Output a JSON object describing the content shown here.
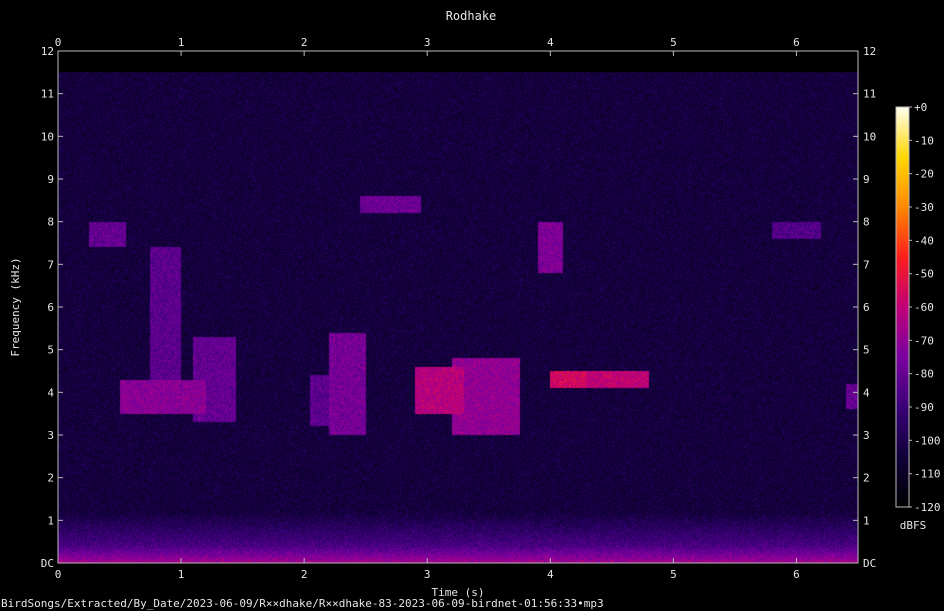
{
  "chart_data": {
    "type": "heatmap",
    "subtype": "spectrogram",
    "title": "Rodhake",
    "xlabel": "Time (s)",
    "ylabel": "Frequency (kHz)",
    "xlim": [
      0,
      6.5
    ],
    "ylim": [
      0,
      12
    ],
    "x_ticks": [
      "0",
      "1",
      "2",
      "3",
      "4",
      "5",
      "6"
    ],
    "y_ticks": [
      "DC",
      "1",
      "2",
      "3",
      "4",
      "5",
      "6",
      "7",
      "8",
      "9",
      "10",
      "11",
      "12"
    ],
    "colorbar": {
      "label": "dBFS",
      "range": [
        -120,
        0
      ],
      "ticks": [
        "+0",
        "-10",
        "-20",
        "-30",
        "-40",
        "-50",
        "-60",
        "-70",
        "-80",
        "-90",
        "-100",
        "-110",
        "-120"
      ],
      "colormap": [
        "#000000",
        "#10003a",
        "#3a0078",
        "#7a00a0",
        "#c0007a",
        "#ff1e1e",
        "#ff8800",
        "#ffd800",
        "#fffff0"
      ]
    },
    "noise_ceiling_khz": 11.5,
    "bird_calls": [
      {
        "t_start": 0.25,
        "t_end": 0.55,
        "f_low": 7.4,
        "f_high": 8.0,
        "level_dbfs": -80
      },
      {
        "t_start": 0.5,
        "t_end": 1.2,
        "f_low": 3.5,
        "f_high": 4.3,
        "level_dbfs": -72
      },
      {
        "t_start": 0.75,
        "t_end": 1.0,
        "f_low": 4.3,
        "f_high": 7.4,
        "level_dbfs": -82
      },
      {
        "t_start": 1.1,
        "t_end": 1.45,
        "f_low": 3.3,
        "f_high": 5.3,
        "level_dbfs": -80
      },
      {
        "t_start": 2.05,
        "t_end": 2.25,
        "f_low": 3.2,
        "f_high": 4.4,
        "level_dbfs": -82
      },
      {
        "t_start": 2.2,
        "t_end": 2.5,
        "f_low": 3.0,
        "f_high": 5.4,
        "level_dbfs": -76
      },
      {
        "t_start": 2.45,
        "t_end": 2.95,
        "f_low": 8.2,
        "f_high": 8.6,
        "level_dbfs": -78
      },
      {
        "t_start": 2.9,
        "t_end": 3.3,
        "f_low": 3.5,
        "f_high": 4.6,
        "level_dbfs": -62
      },
      {
        "t_start": 3.2,
        "t_end": 3.75,
        "f_low": 3.0,
        "f_high": 4.8,
        "level_dbfs": -70
      },
      {
        "t_start": 3.9,
        "t_end": 4.1,
        "f_low": 6.8,
        "f_high": 8.0,
        "level_dbfs": -74
      },
      {
        "t_start": 4.0,
        "t_end": 4.3,
        "f_low": 4.1,
        "f_high": 4.5,
        "level_dbfs": -56
      },
      {
        "t_start": 4.3,
        "t_end": 4.8,
        "f_low": 4.1,
        "f_high": 4.5,
        "level_dbfs": -60
      },
      {
        "t_start": 5.8,
        "t_end": 6.2,
        "f_low": 7.6,
        "f_high": 8.0,
        "level_dbfs": -84
      },
      {
        "t_start": 6.4,
        "t_end": 6.5,
        "f_low": 3.6,
        "f_high": 4.2,
        "level_dbfs": -80
      }
    ]
  },
  "footer": {
    "filename": "BirdSongs/Extracted/By_Date/2023-06-09/R××dhake/R××dhake-83-2023-06-09-birdnet-01:56:33•mp3"
  }
}
